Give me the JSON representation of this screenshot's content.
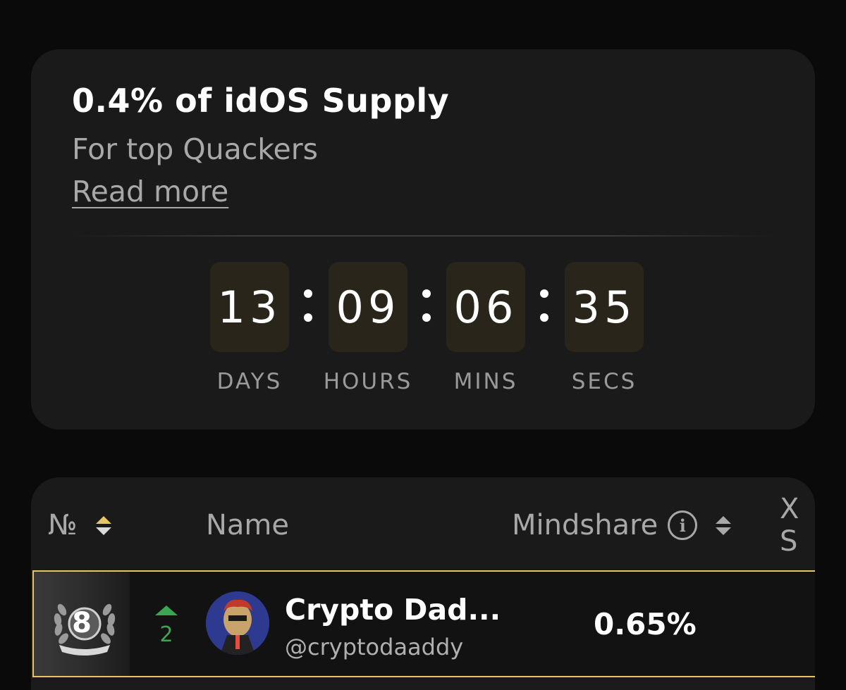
{
  "promo": {
    "title": "0.4% of idOS Supply",
    "subtitle": "For top Quackers",
    "link": "Read more"
  },
  "countdown": {
    "days": "13",
    "hours": "09",
    "mins": "06",
    "secs": "35",
    "labels": {
      "days": "DAYS",
      "hours": "HOURS",
      "mins": "MINS",
      "secs": "SECS"
    }
  },
  "table": {
    "headers": {
      "no": "№",
      "name": "Name",
      "mindshare": "Mindshare",
      "x": "X S"
    },
    "rows": [
      {
        "rank": "8",
        "change": "2",
        "name": "Crypto Dad...",
        "handle": "@cryptodaaddy",
        "mindshare": "0.65%"
      }
    ]
  },
  "colors": {
    "accent": "#e7c560",
    "up": "#3aa654",
    "card": "#1a1a1a",
    "background": "#0a0a0a"
  },
  "icons": [
    "sort-icon",
    "info-icon",
    "laurel-icon",
    "arrow-up-icon",
    "avatar-image"
  ]
}
